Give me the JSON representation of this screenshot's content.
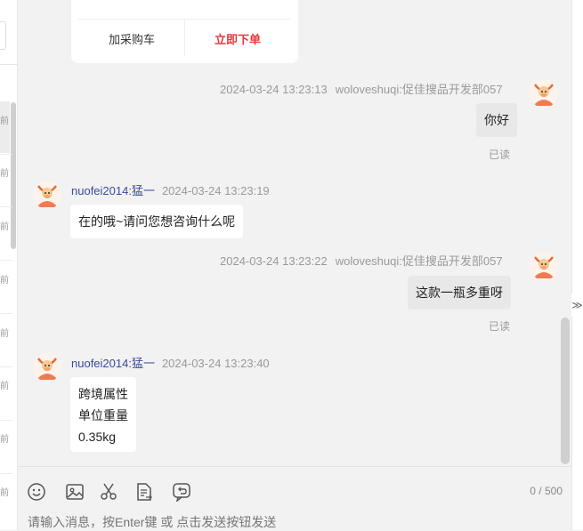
{
  "sidebar": {
    "items": [
      "前",
      "前",
      "前",
      "前",
      "前",
      "前",
      "前",
      "前"
    ]
  },
  "product_card": {
    "cart_label": "加采购车",
    "order_label": "立即下单"
  },
  "messages": [
    {
      "name": "woloveshuqi:促佳搜品开发部057",
      "time": "2024-03-24 13:23:13",
      "text": "你好",
      "read": "已读"
    },
    {
      "name": "nuofei2014:猛一",
      "time": "2024-03-24 13:23:19",
      "text": "在的哦~请问您想咨询什么呢"
    },
    {
      "name": "woloveshuqi:促佳搜品开发部057",
      "time": "2024-03-24 13:23:22",
      "text": "这款一瓶多重呀",
      "read": "已读"
    },
    {
      "name": "nuofei2014:猛一",
      "time": "2024-03-24 13:23:40",
      "lines": [
        "跨境属性",
        "单位重量",
        "0.35kg"
      ]
    }
  ],
  "composer": {
    "counter": "0 / 500",
    "placeholder": "请输入消息，按Enter键 或 点击发送按钮发送",
    "tools": [
      "emoji-icon",
      "image-icon",
      "scissors-icon",
      "document-icon",
      "recall-icon"
    ]
  },
  "colors": {
    "accent": "#e4393c",
    "name": "#3a4a9c",
    "avatar": "#f07a52"
  }
}
